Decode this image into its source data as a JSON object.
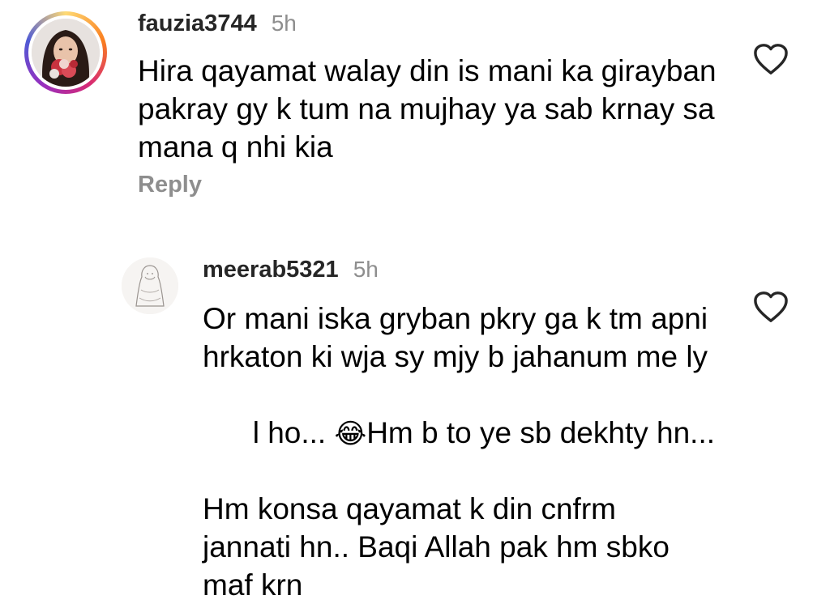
{
  "comments": [
    {
      "username": "fauzia3744",
      "time": "5h",
      "text": "Hira qayamat walay din is mani ka girayban\npakray gy k tum na mujhay ya sab krnay sa\nmana q nhi kia",
      "reply_label": "Reply",
      "avatar_icon": "profile-photo",
      "like_icon": "heart-outline-icon"
    },
    {
      "username": "meerab5321",
      "time": "5h",
      "text_lines": [
        "Or mani iska gryban pkry ga k tm apni",
        "hrkaton ki wja sy mjy b jahanum me ly",
        "Hm konsa qayamat k din cnfrm",
        "jannati hn.. Baqi Allah pak hm sbko",
        "maf krn"
      ],
      "line3_before_emoji": "l ho... ",
      "line3_emoji": "😂",
      "line3_after_emoji": "Hm b to ye sb dekhty hn...",
      "avatar_icon": "profile-sketch",
      "like_icon": "heart-outline-icon"
    }
  ],
  "colors": {
    "username": "#262626",
    "meta": "#8e8e8e",
    "text": "#000000",
    "ring_gradient": [
      "#feda75",
      "#fa7e1e",
      "#d62976",
      "#962fbf",
      "#4f5bd5"
    ]
  }
}
